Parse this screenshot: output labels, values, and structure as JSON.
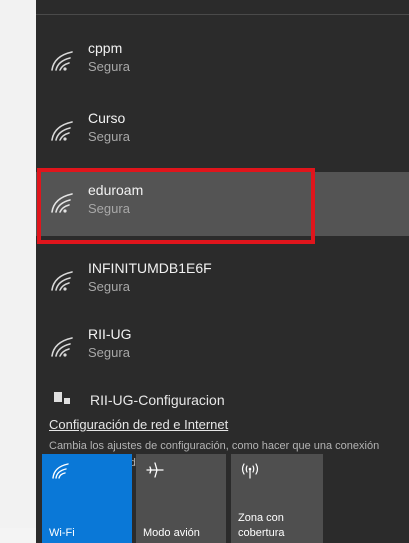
{
  "networks": [
    {
      "name": "cppm",
      "status": "Segura"
    },
    {
      "name": "Curso",
      "status": "Segura"
    },
    {
      "name": "eduroam",
      "status": "Segura"
    },
    {
      "name": "INFINITUMDB1E6F",
      "status": "Segura"
    },
    {
      "name": "RII-UG",
      "status": "Segura"
    }
  ],
  "partial_item": {
    "text": "RII-UG-Configuracion"
  },
  "settings": {
    "link": "Configuración de red e Internet",
    "description": "Cambia los ajustes de configuración, como hacer que una conexión sea de uso medido."
  },
  "tiles": {
    "wifi": {
      "label": "Wi-Fi",
      "icon": "wifi-icon"
    },
    "airplane": {
      "label": "Modo avión",
      "icon": "airplane-icon"
    },
    "hotspot": {
      "label": "Zona con cobertura",
      "icon": "hotspot-icon"
    }
  },
  "colors": {
    "panel": "#2b2b2b",
    "selected": "#545454",
    "highlight": "#e0151c",
    "wifi_tile": "#0a78d7",
    "tile": "#4f4f4f"
  }
}
